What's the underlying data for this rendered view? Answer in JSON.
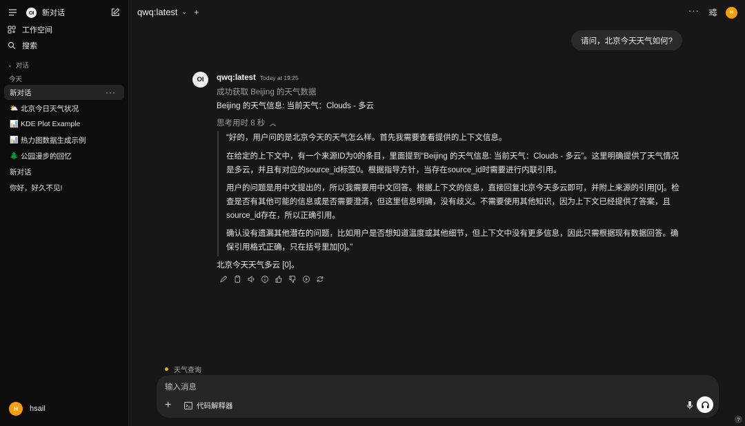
{
  "sidebar": {
    "new_chat_label": "新对话",
    "logo_text": "OI",
    "workspace_label": "工作空间",
    "search_label": "搜索",
    "section_label": "对话",
    "today_label": "今天",
    "chats": [
      {
        "label": "新对话",
        "emoji": "",
        "active": true
      },
      {
        "label": "北京今日天气状况",
        "emoji": "⛅"
      },
      {
        "label": "KDE Plot Example",
        "emoji": "📊"
      },
      {
        "label": "热力图数据生成示例",
        "emoji": "📊"
      },
      {
        "label": "公园漫步的回忆",
        "emoji": "🌲"
      },
      {
        "label": "新对话",
        "emoji": ""
      },
      {
        "label": "你好，好久不见!",
        "emoji": ""
      }
    ],
    "more_label": "···",
    "user": {
      "name": "hsail",
      "initial": "H"
    }
  },
  "header": {
    "model": "qwq:latest",
    "more": "···",
    "avatar_initial": "H"
  },
  "conversation": {
    "user_message": "请问，北京今天天气如何?",
    "assistant": {
      "avatar_text": "OI",
      "name": "qwq:latest",
      "time": "Today at 19:25",
      "status": "成功获取 Beijing 的天气数据",
      "source": "Beijing 的天气信息: 当前天气：Clouds - 多云",
      "thinking_label": "思考用时 8 秒",
      "thinking": [
        "“好的，用户问的是北京今天的天气怎么样。首先我需要查看提供的上下文信息。",
        "在给定的上下文中，有一个来源ID为0的条目，里面提到“Beijing 的天气信息: 当前天气：Clouds - 多云”。这里明确提供了天气情况是多云，并且有对应的source_id标签0。根据指导方针，当存在source_id时需要进行内联引用。",
        "用户的问题是用中文提出的，所以我需要用中文回答。根据上下文的信息，直接回复北京今天多云即可，并附上来源的引用[0]。检查是否有其他可能的信息或是否需要澄清，但这里信息明确，没有歧义。不需要使用其他知识，因为上下文已经提供了答案，且source_id存在，所以正确引用。",
        "确认没有遗漏其他潜在的问题，比如用户是否想知道温度或其他细节，但上下文中没有更多信息，因此只需根据现有数据回答。确保引用格式正确，只在括号里加[0]。”"
      ],
      "answer": "北京今天天气多云 [0]。"
    }
  },
  "composer": {
    "tool_hint": "天气查询",
    "placeholder": "输入消息",
    "add_label": "+",
    "code_interpreter_label": "代码解释器"
  },
  "help_label": "?",
  "colors": {
    "accent_avatar": "#f59e0b",
    "tool_dot": "#eab308",
    "background": "#171717",
    "sidebar": "#0d0d0d"
  }
}
